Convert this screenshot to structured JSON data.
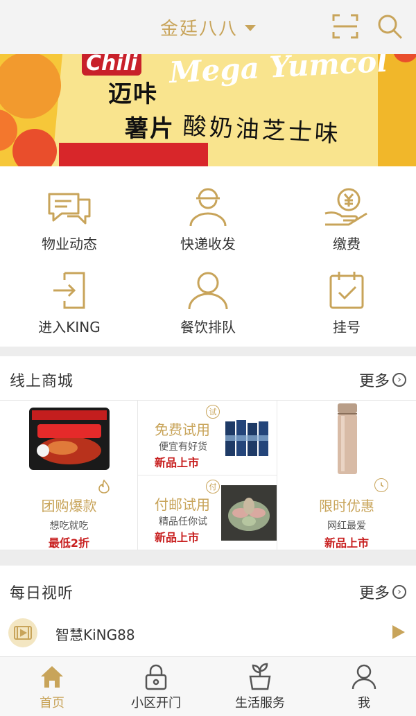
{
  "header": {
    "title": "金廷八八",
    "scan_icon": "scan-icon",
    "search_icon": "search-icon"
  },
  "banner": {
    "brand_left": "Chili",
    "brand_right": "Mega Yumcol",
    "line1": "迈咔",
    "line2": "薯片",
    "flavor": "酸奶油芝士味"
  },
  "quick_menu": [
    {
      "label": "物业动态",
      "icon": "message-icon"
    },
    {
      "label": "快递收发",
      "icon": "courier-icon"
    },
    {
      "label": "缴费",
      "icon": "payment-icon"
    },
    {
      "label": "进入KING",
      "icon": "enter-icon"
    },
    {
      "label": "餐饮排队",
      "icon": "user-icon"
    },
    {
      "label": "挂号",
      "icon": "calendar-icon"
    }
  ],
  "mall": {
    "title": "线上商城",
    "more": "更多",
    "group_buy": {
      "title": "团购爆款",
      "sub": "想吃就吃",
      "promo": "最低2折",
      "badge_icon": "fire-icon"
    },
    "free_trial": {
      "title": "免费试用",
      "sub": "便宜有好货",
      "promo": "新品上市",
      "badge": "试"
    },
    "paid_trial": {
      "title": "付邮试用",
      "sub": "精品任你试",
      "promo": "新品上市",
      "badge": "付"
    },
    "limited": {
      "title": "限时优惠",
      "sub": "网红最爱",
      "promo": "新品上市",
      "badge_icon": "clock-icon"
    }
  },
  "daily": {
    "title": "每日视听",
    "more": "更多",
    "item": "智慧KiNG88"
  },
  "tabs": [
    {
      "label": "首页",
      "icon": "home-icon",
      "active": true
    },
    {
      "label": "小区开门",
      "icon": "lock-icon",
      "active": false
    },
    {
      "label": "生活服务",
      "icon": "plant-icon",
      "active": false
    },
    {
      "label": "我",
      "icon": "profile-icon",
      "active": false
    }
  ],
  "colors": {
    "accent": "#c8a45a",
    "promo": "#c82020",
    "banner": "#f6c739"
  }
}
